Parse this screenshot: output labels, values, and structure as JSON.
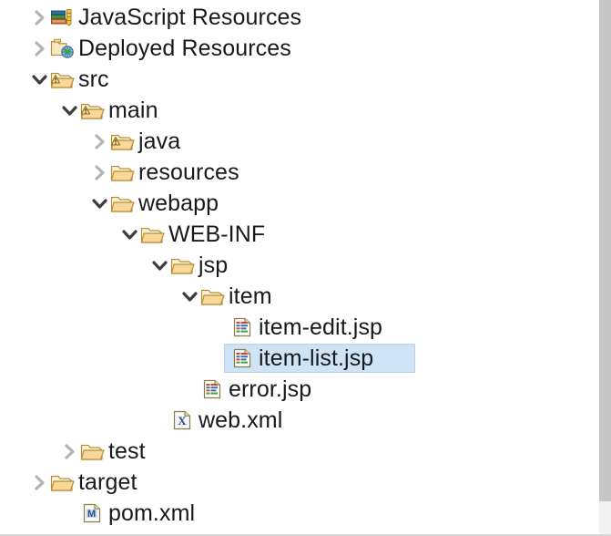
{
  "panel": {
    "name": "project-explorer-tree",
    "background": "#ffffff",
    "selection_color": "#cfe3f7",
    "text_color": "#18191c",
    "folder_color": "#e8bb6d"
  },
  "scrollbar": {
    "present": true,
    "track_color": "#f2f2f2",
    "thumb_color": "#c6c6c6"
  },
  "tree": {
    "rows": [
      {
        "label": "JavaScript Resources",
        "depth": 0,
        "twisty": "collapsed",
        "icon": "javascript-resources-icon",
        "selected": false
      },
      {
        "label": "Deployed Resources",
        "depth": 0,
        "twisty": "collapsed",
        "icon": "deployed-resources-icon",
        "selected": false
      },
      {
        "label": "src",
        "depth": 0,
        "twisty": "expanded",
        "icon": "folder-warning-icon",
        "selected": false
      },
      {
        "label": "main",
        "depth": 1,
        "twisty": "expanded",
        "icon": "folder-warning-icon",
        "selected": false
      },
      {
        "label": "java",
        "depth": 2,
        "twisty": "collapsed",
        "icon": "folder-warning-icon",
        "selected": false
      },
      {
        "label": "resources",
        "depth": 2,
        "twisty": "collapsed",
        "icon": "folder-icon",
        "selected": false
      },
      {
        "label": "webapp",
        "depth": 2,
        "twisty": "expanded",
        "icon": "folder-icon",
        "selected": false
      },
      {
        "label": "WEB-INF",
        "depth": 3,
        "twisty": "expanded",
        "icon": "folder-icon",
        "selected": false
      },
      {
        "label": "jsp",
        "depth": 4,
        "twisty": "expanded",
        "icon": "folder-icon",
        "selected": false
      },
      {
        "label": "item",
        "depth": 5,
        "twisty": "expanded",
        "icon": "folder-icon",
        "selected": false
      },
      {
        "label": "item-edit.jsp",
        "depth": 6,
        "twisty": "none",
        "icon": "jsp-file-icon",
        "selected": false
      },
      {
        "label": "item-list.jsp",
        "depth": 6,
        "twisty": "none",
        "icon": "jsp-file-icon",
        "selected": true
      },
      {
        "label": "error.jsp",
        "depth": 5,
        "twisty": "none",
        "icon": "jsp-file-icon",
        "selected": false
      },
      {
        "label": "web.xml",
        "depth": 4,
        "twisty": "none",
        "icon": "xml-file-icon",
        "selected": false
      },
      {
        "label": "test",
        "depth": 1,
        "twisty": "collapsed",
        "icon": "folder-icon",
        "selected": false
      },
      {
        "label": "target",
        "depth": 0,
        "twisty": "collapsed",
        "icon": "folder-icon",
        "selected": false
      },
      {
        "label": "pom.xml",
        "depth": 1,
        "twisty": "none",
        "icon": "maven-pom-icon",
        "selected": false
      }
    ]
  }
}
